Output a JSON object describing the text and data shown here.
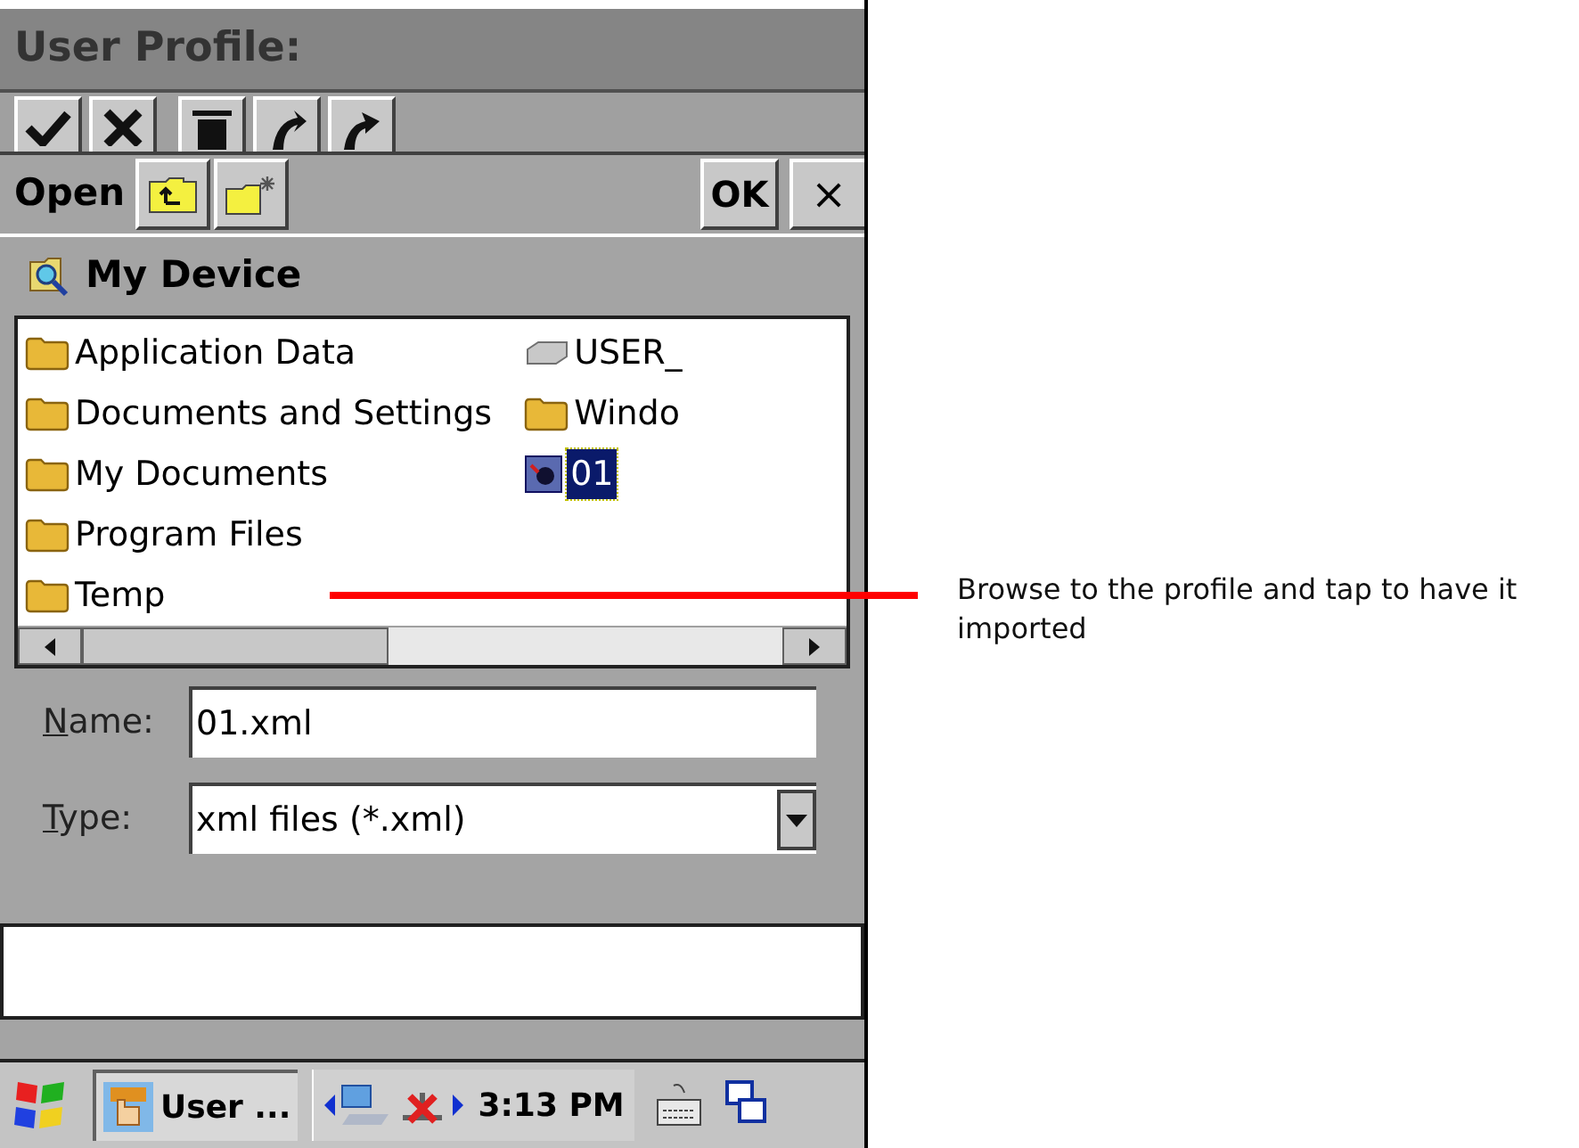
{
  "title": "User Profile:",
  "dialog": {
    "title": "Open",
    "ok_button": "OK",
    "close_button": "×",
    "location": "My Device",
    "files": [
      {
        "name": "Application Data",
        "kind": "folder",
        "selected": false
      },
      {
        "name": "Documents and Settings",
        "kind": "folder",
        "selected": false
      },
      {
        "name": "My Documents",
        "kind": "folder",
        "selected": false
      },
      {
        "name": "Program Files",
        "kind": "folder",
        "selected": false
      },
      {
        "name": "Temp",
        "kind": "folder",
        "selected": false
      },
      {
        "name": "USER_",
        "kind": "drive",
        "selected": false
      },
      {
        "name": "Windo",
        "kind": "folder",
        "selected": false
      },
      {
        "name": "01",
        "kind": "file",
        "selected": true
      }
    ],
    "name_label": "Name:",
    "name_value": "01.xml",
    "type_label": "Type:",
    "type_value": "xml files (*.xml)"
  },
  "taskbar": {
    "task": "User ...",
    "clock": "3:13 PM"
  },
  "annotation": "Browse to the profile and tap to have it imported"
}
